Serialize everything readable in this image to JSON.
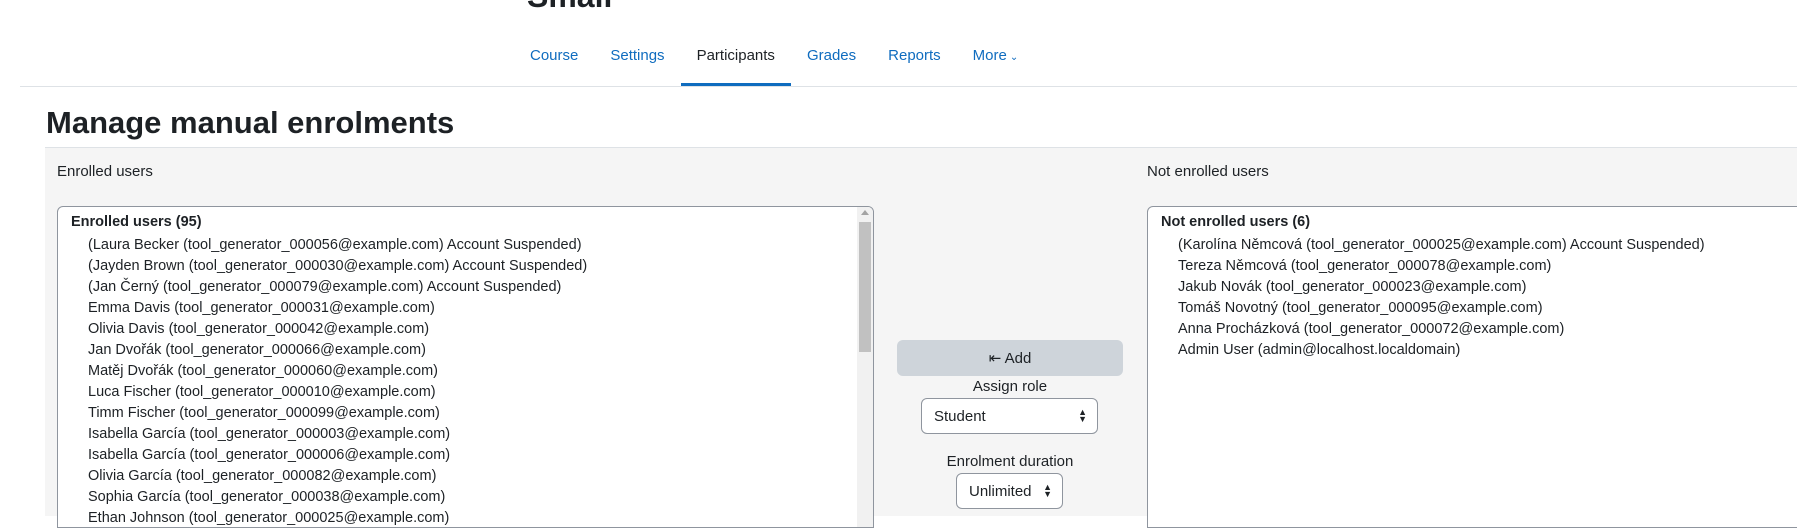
{
  "course": {
    "title": "Small"
  },
  "nav": {
    "items": [
      {
        "label": "Course"
      },
      {
        "label": "Settings"
      },
      {
        "label": "Participants"
      },
      {
        "label": "Grades"
      },
      {
        "label": "Reports"
      },
      {
        "label": "More"
      }
    ],
    "active": "Participants"
  },
  "page": {
    "heading": "Manage manual enrolments"
  },
  "enrolled": {
    "column_label": "Enrolled users",
    "group_label": "Enrolled users (95)",
    "users": [
      "(Laura Becker (tool_generator_000056@example.com) Account Suspended)",
      "(Jayden Brown (tool_generator_000030@example.com) Account Suspended)",
      "(Jan Černý (tool_generator_000079@example.com) Account Suspended)",
      "Emma Davis (tool_generator_000031@example.com)",
      "Olivia Davis (tool_generator_000042@example.com)",
      "Jan Dvořák (tool_generator_000066@example.com)",
      "Matěj Dvořák (tool_generator_000060@example.com)",
      "Luca Fischer (tool_generator_000010@example.com)",
      "Timm Fischer (tool_generator_000099@example.com)",
      "Isabella García (tool_generator_000003@example.com)",
      "Isabella García (tool_generator_000006@example.com)",
      "Olivia García (tool_generator_000082@example.com)",
      "Sophia García (tool_generator_000038@example.com)",
      "Ethan Johnson (tool_generator_000025@example.com)"
    ]
  },
  "controls": {
    "add_label": "⇤ Add",
    "assign_role_label": "Assign role",
    "role_value": "Student",
    "enrolment_duration_label": "Enrolment duration",
    "duration_value": "Unlimited"
  },
  "not_enrolled": {
    "column_label": "Not enrolled users",
    "group_label": "Not enrolled users (6)",
    "users": [
      "(Karolína Němcová (tool_generator_000025@example.com) Account Suspended)",
      "Tereza Němcová (tool_generator_000078@example.com)",
      "Jakub Novák (tool_generator_000023@example.com)",
      "Tomáš Novotný (tool_generator_000095@example.com)",
      "Anna Procházková (tool_generator_000072@example.com)",
      "Admin User (admin@localhost.localdomain)"
    ]
  },
  "colors": {
    "link": "#0f6cbf",
    "text": "#1d2125",
    "panel_bg": "#f5f5f5",
    "button_bg": "#ced4da",
    "border": "#8f959e"
  }
}
